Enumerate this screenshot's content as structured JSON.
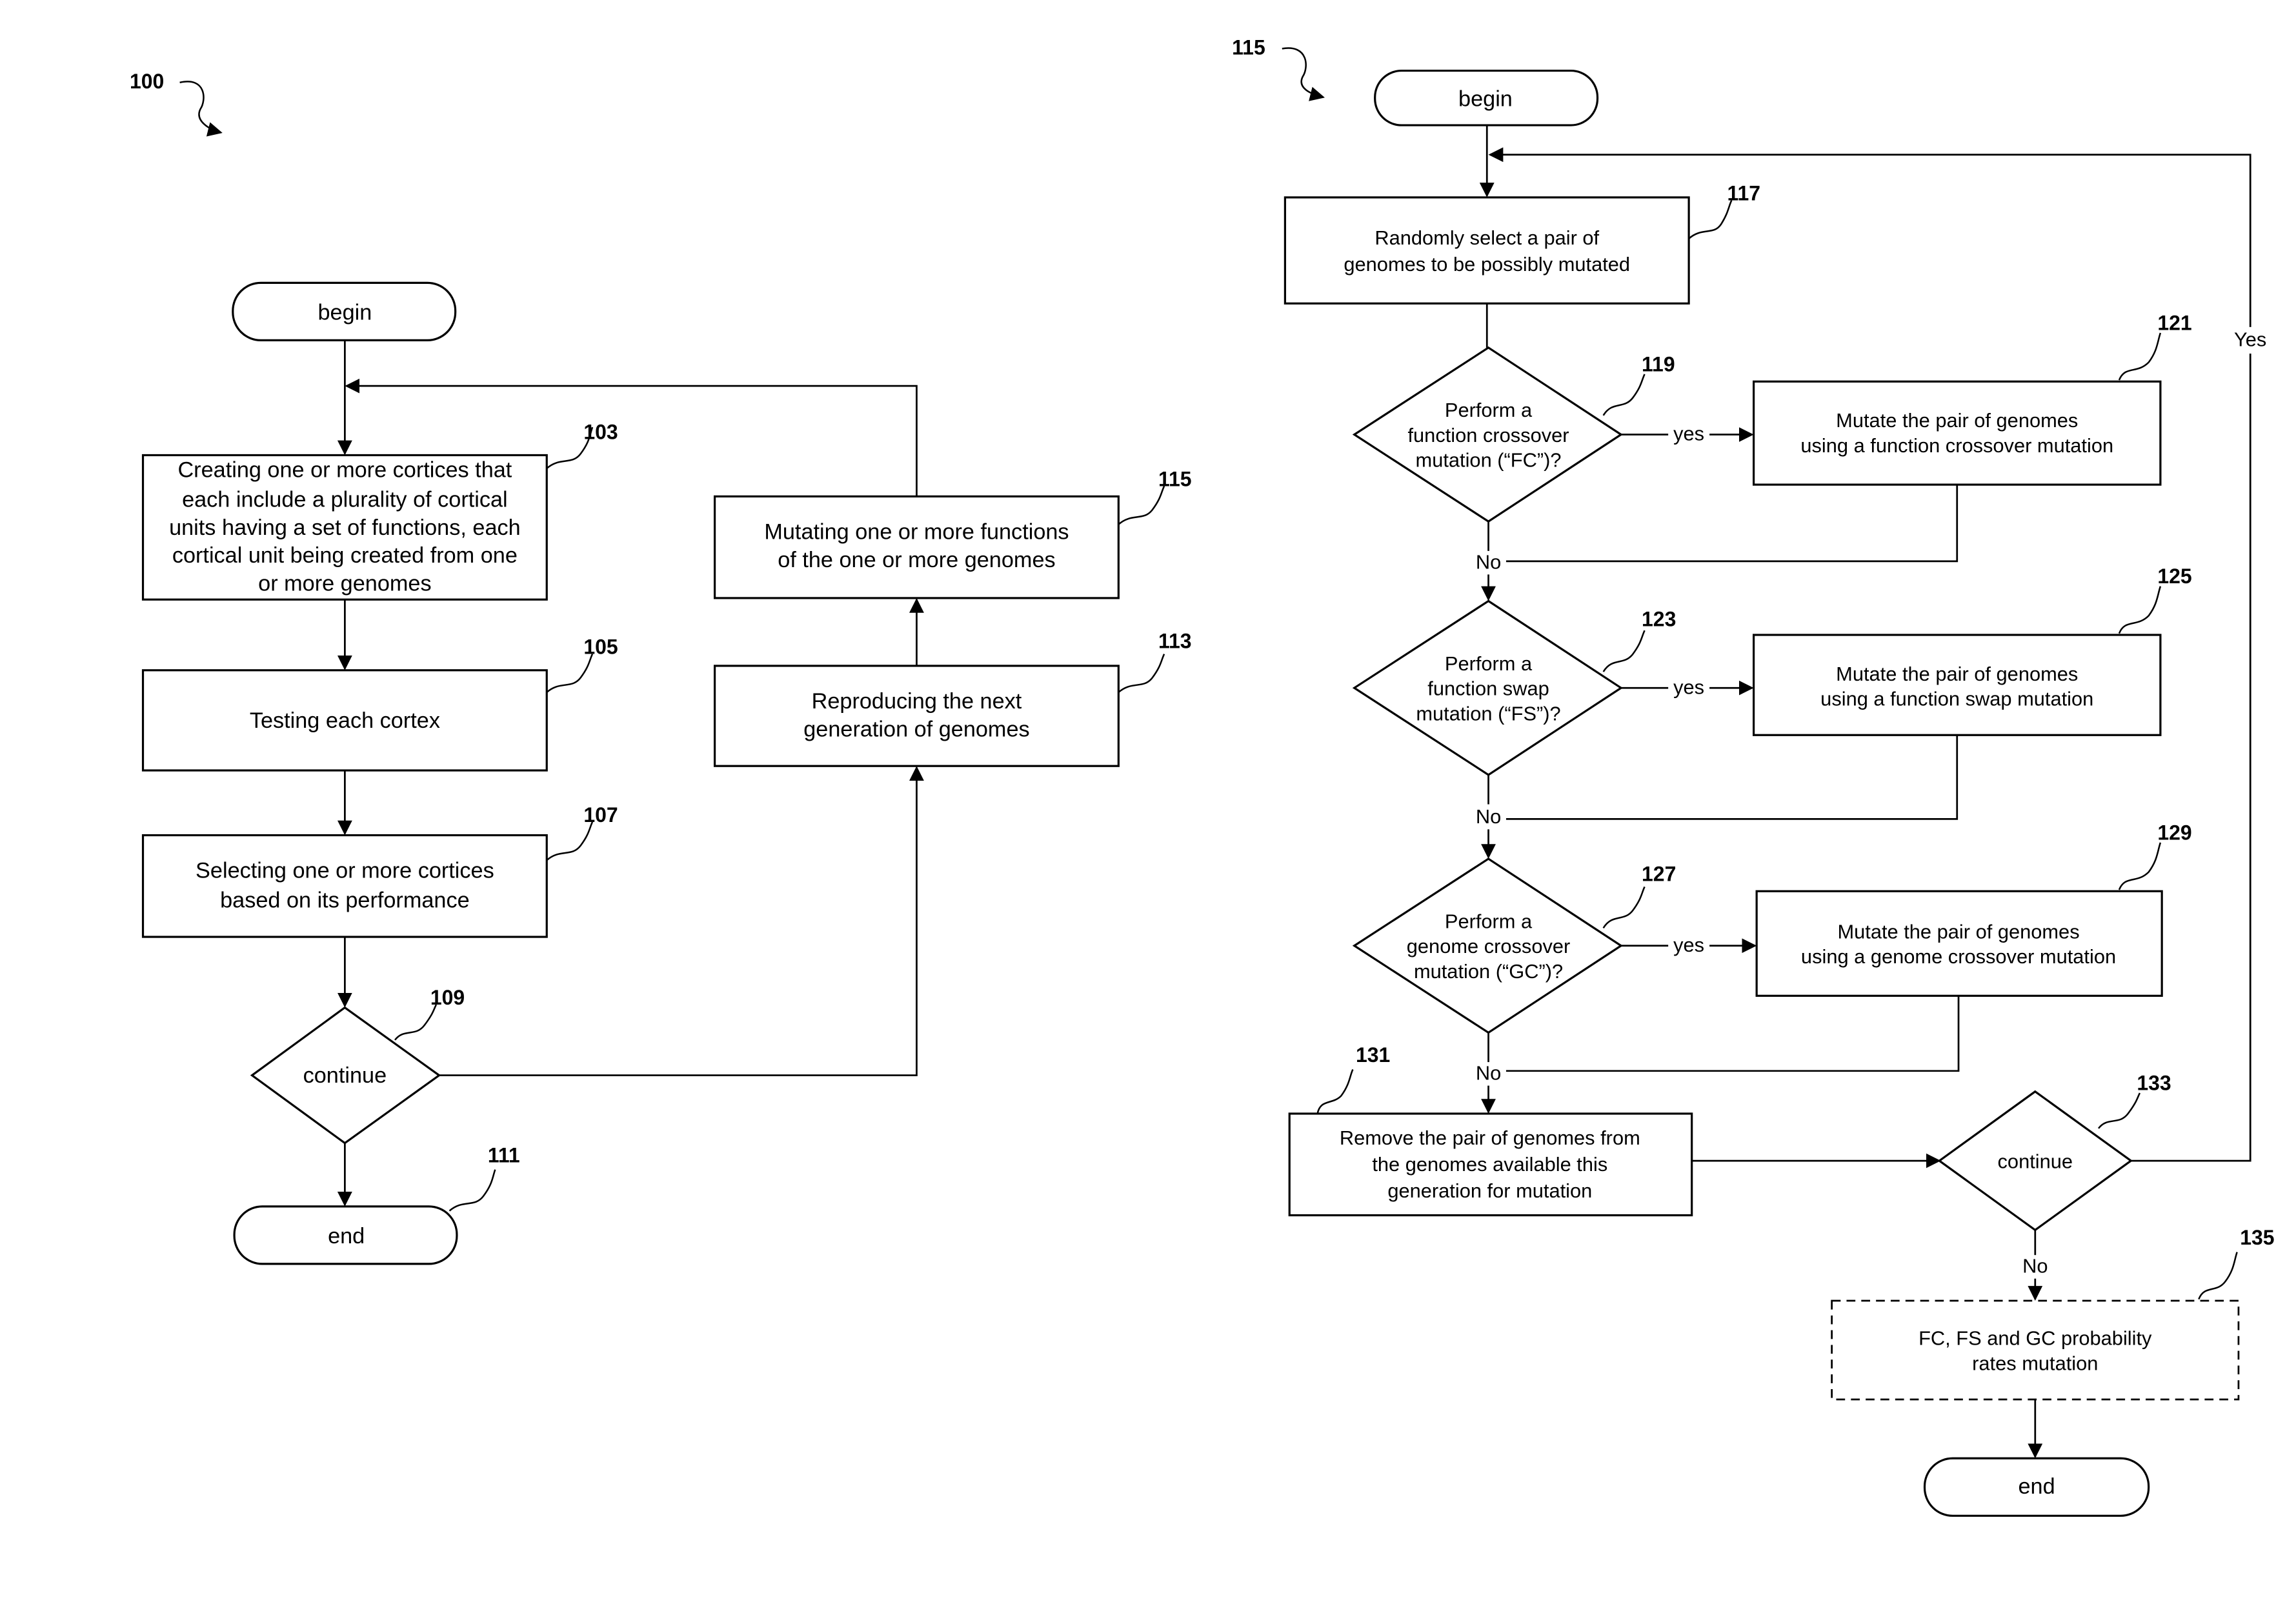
{
  "figure_labels": {
    "left": "100",
    "right": "115"
  },
  "left_flow": {
    "begin": "begin",
    "end": "end",
    "step_103": {
      "ref": "103",
      "lines": [
        "Creating one or more cortices that",
        "each include a plurality of cortical",
        "units having a set of functions, each",
        "cortical unit being created from one",
        "or more genomes"
      ]
    },
    "step_105": {
      "ref": "105",
      "lines": [
        "Testing each cortex"
      ]
    },
    "step_107": {
      "ref": "107",
      "lines": [
        "Selecting one or more cortices",
        "based on its performance"
      ]
    },
    "step_109": {
      "ref": "109",
      "lines": [
        "continue"
      ]
    },
    "step_111": {
      "ref": "111"
    },
    "step_113": {
      "ref": "113",
      "lines": [
        "Reproducing the next",
        "generation of genomes"
      ]
    },
    "step_115": {
      "ref": "115",
      "lines": [
        "Mutating one or more functions",
        "of the one or more genomes"
      ]
    }
  },
  "right_flow": {
    "begin": "begin",
    "end": "end",
    "step_117": {
      "ref": "117",
      "lines": [
        "Randomly select a pair of",
        "genomes to be possibly mutated"
      ]
    },
    "step_119": {
      "ref": "119",
      "lines": [
        "Perform a",
        "function crossover",
        "mutation (“FC”)?"
      ]
    },
    "step_121": {
      "ref": "121",
      "lines": [
        "Mutate the pair of genomes",
        "using a function crossover mutation"
      ]
    },
    "step_123": {
      "ref": "123",
      "lines": [
        "Perform a",
        "function swap",
        "mutation (“FS”)?"
      ]
    },
    "step_125": {
      "ref": "125",
      "lines": [
        "Mutate the pair of genomes",
        "using a function swap mutation"
      ]
    },
    "step_127": {
      "ref": "127",
      "lines": [
        "Perform a",
        "genome crossover",
        "mutation (“GC”)?"
      ]
    },
    "step_129": {
      "ref": "129",
      "lines": [
        "Mutate the pair of genomes",
        "using a genome crossover mutation"
      ]
    },
    "step_131": {
      "ref": "131",
      "lines": [
        "Remove the pair of genomes from",
        "the genomes available this",
        "generation for mutation"
      ]
    },
    "step_133": {
      "ref": "133",
      "lines": [
        "continue"
      ]
    },
    "step_135": {
      "ref": "135",
      "lines": [
        "FC, FS and GC probability",
        "rates mutation"
      ]
    },
    "labels": {
      "yes": "yes",
      "no": "No",
      "Yes": "Yes"
    }
  }
}
